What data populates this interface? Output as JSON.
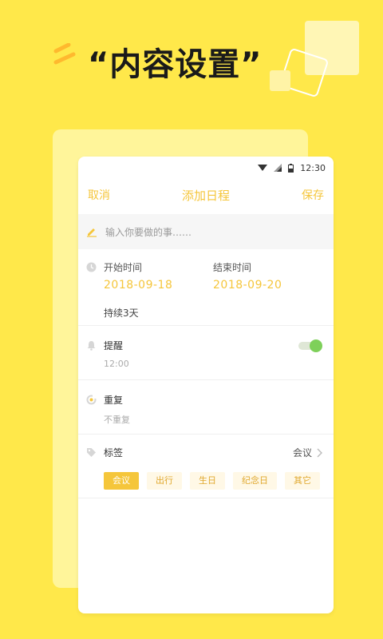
{
  "promo": {
    "title": "“内容设置”"
  },
  "status_bar": {
    "time": "12:30"
  },
  "nav": {
    "cancel": "取消",
    "title": "添加日程",
    "save": "保存"
  },
  "task_input": {
    "placeholder": "输入你要做的事……"
  },
  "time": {
    "start_label": "开始时间",
    "start_date": "2018-09-18",
    "end_label": "结束时间",
    "end_date": "2018-09-20",
    "duration": "持续3天"
  },
  "reminder": {
    "label": "提醒",
    "time": "12:00",
    "enabled": true
  },
  "repeat": {
    "label": "重复",
    "value": "不重复"
  },
  "tags": {
    "label": "标签",
    "selected": "会议",
    "chips": [
      "会议",
      "出行",
      "生日",
      "纪念日",
      "其它"
    ]
  },
  "colors": {
    "accent": "#f5c63b",
    "background": "#ffe84a",
    "toggle_on": "#7ed05a"
  },
  "icons": {
    "task": "pencil-icon",
    "time": "clock-icon",
    "reminder": "bell-icon",
    "repeat": "repeat-icon",
    "tags": "tag-icon",
    "tags_more": "chevron-right-icon"
  }
}
